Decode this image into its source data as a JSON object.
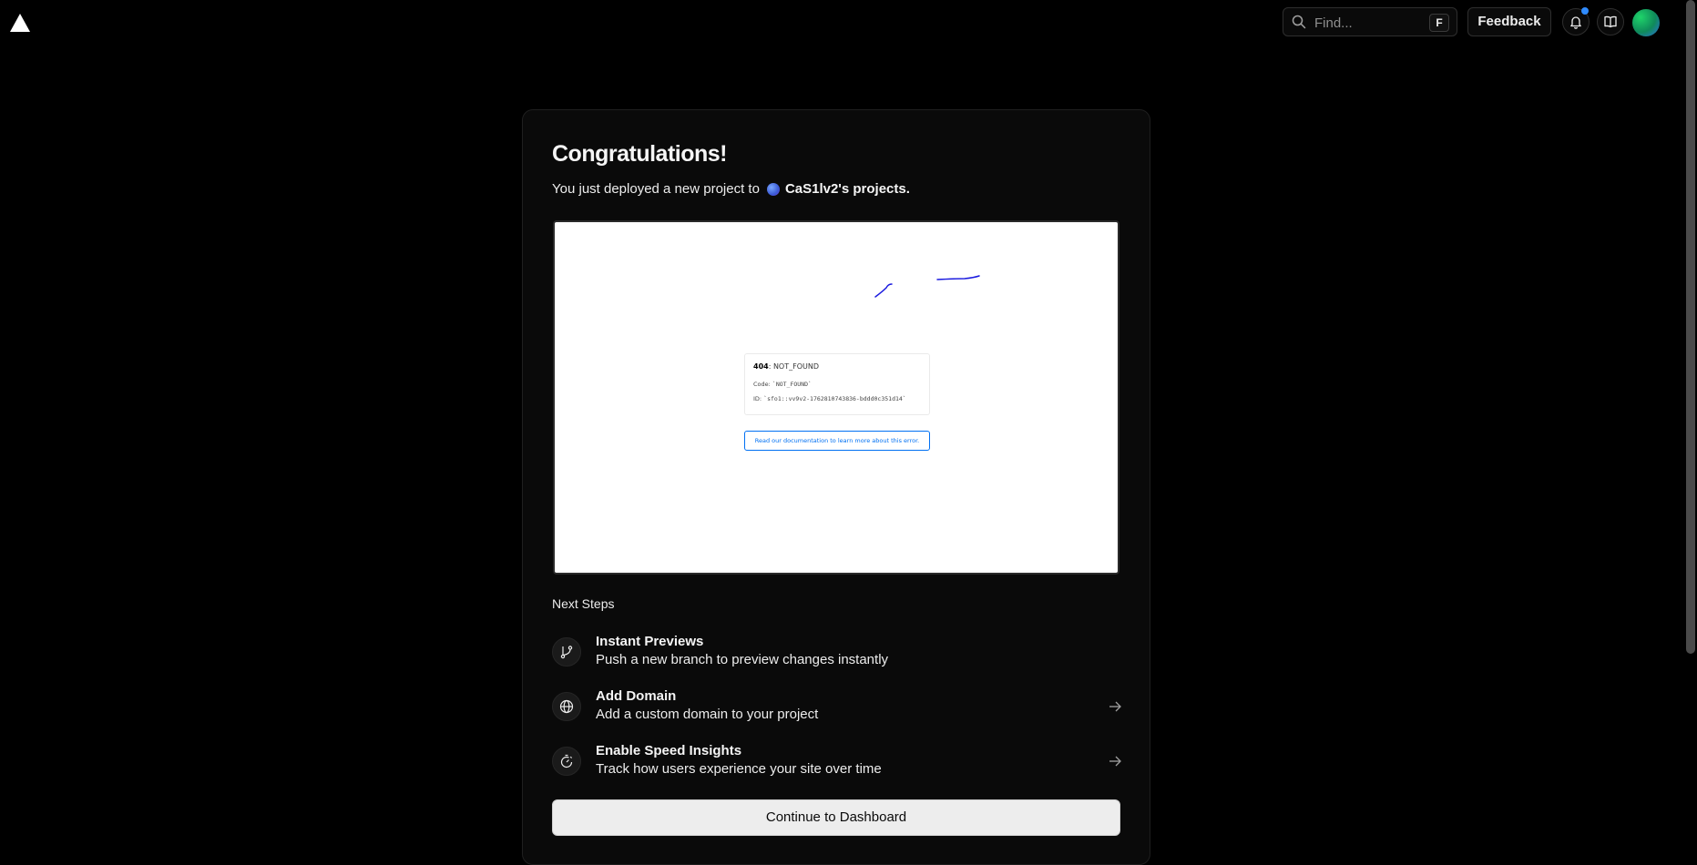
{
  "topbar": {
    "logo_icon": "vercel-triangle-icon",
    "search": {
      "placeholder": "Find...",
      "shortcut": "F"
    },
    "feedback_label": "Feedback",
    "notification_icon": "bell-icon",
    "docs_icon": "book-icon",
    "notification_dot_color": "#2f8bff"
  },
  "card": {
    "title": "Congratulations!",
    "subtitle_prefix": "You just deployed a new project to",
    "team_name": "CaS1lv2's projects."
  },
  "preview": {
    "error_code": "404",
    "error_status": ": NOT_FOUND",
    "code_label": "Code: ",
    "code_value": "`NOT_FOUND`",
    "id_label": "ID: ",
    "id_value": "`sfo1::vv9v2-1762810743836-bddd0c351d14`",
    "link_text": "Read our documentation to learn more about this error."
  },
  "next_steps": {
    "heading": "Next Steps",
    "items": [
      {
        "title": "Instant Previews",
        "description": "Push a new branch to preview changes instantly",
        "icon": "git-branch-icon"
      },
      {
        "title": "Add Domain",
        "description": "Add a custom domain to your project",
        "icon": "globe-icon"
      },
      {
        "title": "Enable Speed Insights",
        "description": "Track how users experience your site over time",
        "icon": "stopwatch-icon"
      }
    ]
  },
  "continue_label": "Continue to Dashboard"
}
